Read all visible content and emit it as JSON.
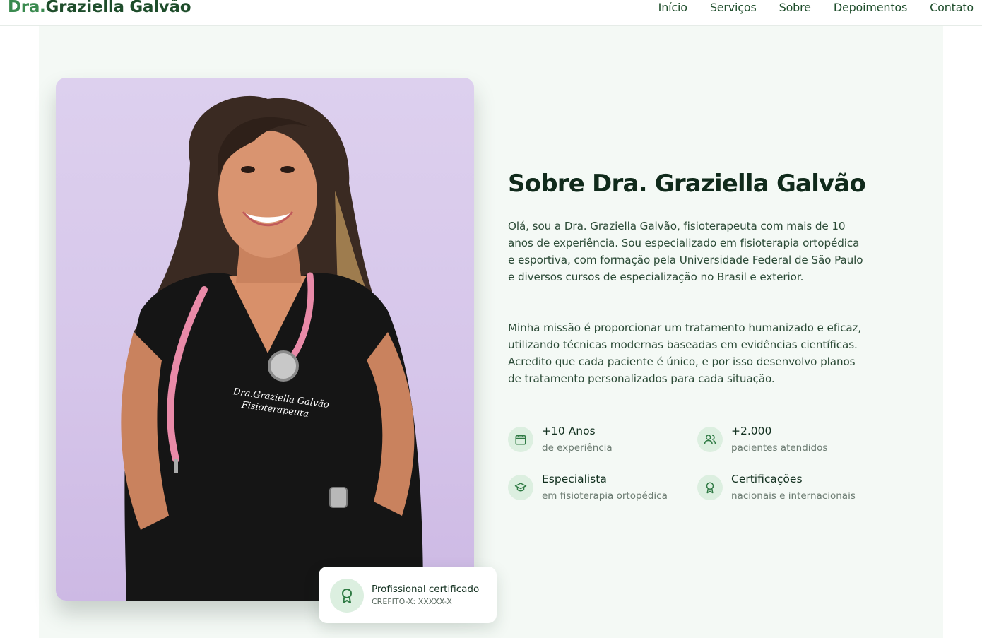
{
  "header": {
    "brand_prefix": "Dra.",
    "brand_name": "Graziella Galvão",
    "nav": [
      "Início",
      "Serviços",
      "Sobre",
      "Depoimentos",
      "Contato"
    ]
  },
  "about": {
    "title": "Sobre Dra. Graziella Galvão",
    "paragraph1": "Olá, sou a Dra. Graziella Galvão, fisioterapeuta com mais de 10 anos de experiência. Sou especializado em fisioterapia ortopédica e esportiva, com formação pela Universidade Federal de São Paulo e diversos cursos de especialização no Brasil e exterior.",
    "paragraph2": "Minha missão é proporcionar um tratamento humanizado e eficaz, utilizando técnicas modernas baseadas em evidências científicas. Acredito que cada paciente é único, e por isso desenvolvo planos de tratamento personalizados para cada situação.",
    "stats": [
      {
        "icon": "calendar-icon",
        "heading": "+10 Anos",
        "sub": "de experiência"
      },
      {
        "icon": "users-icon",
        "heading": "+2.000",
        "sub": "pacientes atendidos"
      },
      {
        "icon": "graduation-cap-icon",
        "heading": "Especialista",
        "sub": "em fisioterapia ortopédica"
      },
      {
        "icon": "award-icon",
        "heading": "Certificações",
        "sub": "nacionais e internacionais"
      }
    ],
    "photo": {
      "embroidery_line1": "Dra.Graziella Galvão",
      "embroidery_line2": "Fisioterapeuta"
    },
    "badge": {
      "icon": "award-icon",
      "title": "Profissional certificado",
      "subtitle": "CREFITO-X: XXXXX-X"
    }
  },
  "colors": {
    "brand_dark": "#1e4d2b",
    "brand_accent": "#3a8a4f",
    "section_bg": "#f4f9f5",
    "icon_circle": "#dcefe0",
    "photo_bg": "#d6c6ea"
  }
}
